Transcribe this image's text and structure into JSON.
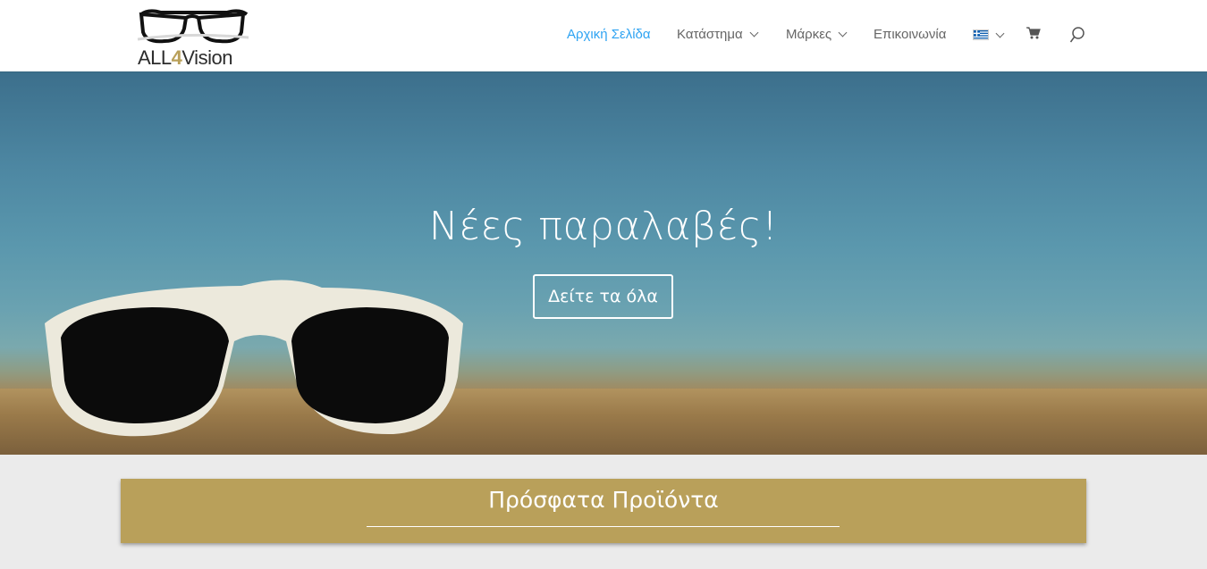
{
  "brand": {
    "logo_text_prefix": "ALL",
    "logo_text_digit": "4",
    "logo_text_suffix": "Vision",
    "accent_color": "#b9a05a"
  },
  "nav": {
    "home": "Αρχική Σελίδα",
    "shop": "Κατάστημα",
    "brands": "Μάρκες",
    "contact": "Επικοινωνία",
    "active_color": "#2ea3f2",
    "icons": {
      "language": "greek-flag-icon",
      "cart": "cart-icon",
      "search": "search-icon"
    }
  },
  "hero": {
    "title": "Νέες παραλαβές!",
    "button_label": "Δείτε τα όλα"
  },
  "recent": {
    "title": "Πρόσφατα Προϊόντα"
  }
}
